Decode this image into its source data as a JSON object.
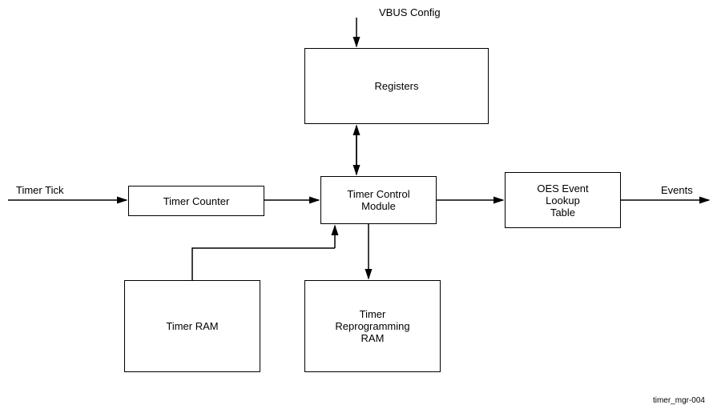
{
  "labels": {
    "vbus_config": "VBUS Config",
    "timer_tick": "Timer Tick",
    "events": "Events"
  },
  "boxes": {
    "registers": "Registers",
    "timer_counter": "Timer Counter",
    "timer_control_module": "Timer Control\nModule",
    "oes_event_lookup_table": "OES Event\nLookup\nTable",
    "timer_ram": "Timer RAM",
    "timer_reprogramming_ram": "Timer\nReprogramming\nRAM"
  },
  "footer": {
    "id": "timer_mgr-004"
  }
}
